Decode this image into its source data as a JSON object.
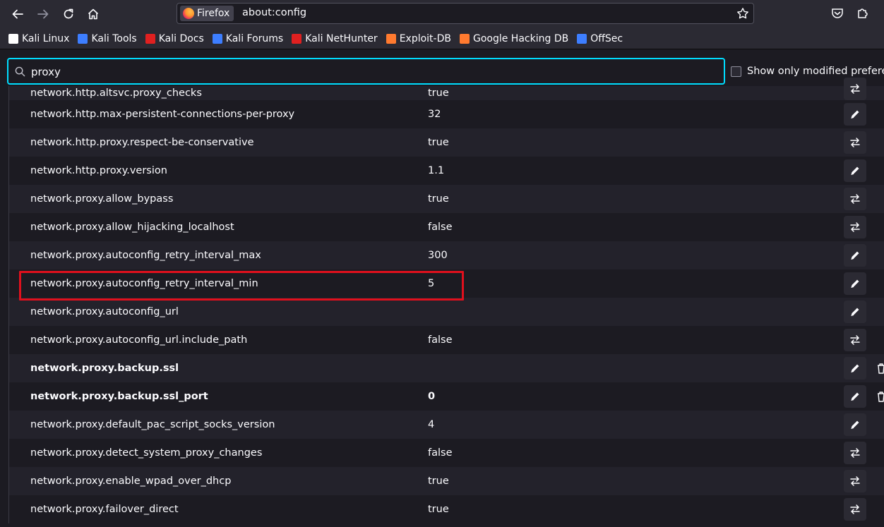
{
  "browser": {
    "identity_label": "Firefox",
    "url": "about:config"
  },
  "bookmarks": [
    {
      "label": "Kali Linux",
      "icon": "kali-dragon-icon",
      "color": "#ffffff"
    },
    {
      "label": "Kali Tools",
      "icon": "kali-tools-icon",
      "color": "#3d7eff"
    },
    {
      "label": "Kali Docs",
      "icon": "kali-docs-icon",
      "color": "#e02020"
    },
    {
      "label": "Kali Forums",
      "icon": "kali-forums-icon",
      "color": "#3d7eff"
    },
    {
      "label": "Kali NetHunter",
      "icon": "kali-nethunter-icon",
      "color": "#e02020"
    },
    {
      "label": "Exploit-DB",
      "icon": "exploit-db-icon",
      "color": "#ff7a2f"
    },
    {
      "label": "Google Hacking DB",
      "icon": "ghdb-icon",
      "color": "#ff7a2f"
    },
    {
      "label": "OffSec",
      "icon": "offsec-icon",
      "color": "#3d7eff"
    }
  ],
  "search": {
    "value": "proxy",
    "modified_label": "Show only modified preferences"
  },
  "prefs": [
    {
      "name": "network.http.altsvc.proxy_checks",
      "value": "true",
      "action": "toggle",
      "modified": false
    },
    {
      "name": "network.http.max-persistent-connections-per-proxy",
      "value": "32",
      "action": "edit",
      "modified": false
    },
    {
      "name": "network.http.proxy.respect-be-conservative",
      "value": "true",
      "action": "toggle",
      "modified": false
    },
    {
      "name": "network.http.proxy.version",
      "value": "1.1",
      "action": "edit",
      "modified": false
    },
    {
      "name": "network.proxy.allow_bypass",
      "value": "true",
      "action": "toggle",
      "modified": false
    },
    {
      "name": "network.proxy.allow_hijacking_localhost",
      "value": "false",
      "action": "toggle",
      "modified": false
    },
    {
      "name": "network.proxy.autoconfig_retry_interval_max",
      "value": "300",
      "action": "edit",
      "modified": false
    },
    {
      "name": "network.proxy.autoconfig_retry_interval_min",
      "value": "5",
      "action": "edit",
      "modified": false
    },
    {
      "name": "network.proxy.autoconfig_url",
      "value": "",
      "action": "edit",
      "modified": false
    },
    {
      "name": "network.proxy.autoconfig_url.include_path",
      "value": "false",
      "action": "toggle",
      "modified": false
    },
    {
      "name": "network.proxy.backup.ssl",
      "value": "",
      "action": "edit",
      "modified": true
    },
    {
      "name": "network.proxy.backup.ssl_port",
      "value": "0",
      "action": "edit",
      "modified": true
    },
    {
      "name": "network.proxy.default_pac_script_socks_version",
      "value": "4",
      "action": "edit",
      "modified": false
    },
    {
      "name": "network.proxy.detect_system_proxy_changes",
      "value": "false",
      "action": "toggle",
      "modified": false
    },
    {
      "name": "network.proxy.enable_wpad_over_dhcp",
      "value": "true",
      "action": "toggle",
      "modified": false
    },
    {
      "name": "network.proxy.failover_direct",
      "value": "true",
      "action": "toggle",
      "modified": false
    }
  ],
  "colors": {
    "accent_focus": "#00ddff",
    "highlight_box": "#e0101d",
    "row_alt": "#23222b",
    "background": "#1c1b22"
  }
}
